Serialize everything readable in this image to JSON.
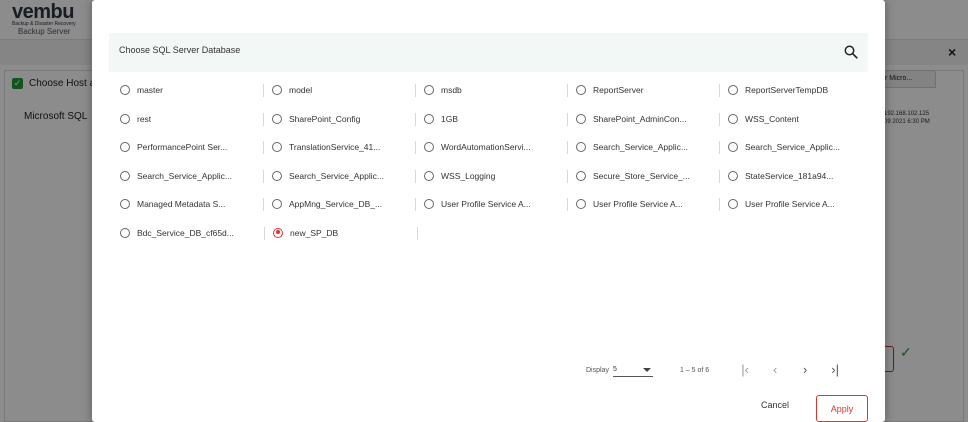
{
  "app": {
    "logo": "vembu",
    "logo_tagline": "Backup & Disaster Recovery",
    "header_subtitle": "Backup Server",
    "close_symbol": "×",
    "choose_host_label": "Choose Host a",
    "microsoft_label": "Microsoft SQL",
    "tab_label": "r Micro...",
    "host_ip": "192.168.102.125",
    "host_date": "09 2021 6:30 PM",
    "tick_symbol": "✓"
  },
  "modal": {
    "title": "Choose SQL Server Database",
    "search_icon": "search-icon",
    "databases": [
      [
        {
          "label": "master",
          "selected": false
        },
        {
          "label": "model",
          "selected": false
        },
        {
          "label": "msdb",
          "selected": false
        },
        {
          "label": "ReportServer",
          "selected": false
        },
        {
          "label": "ReportServerTempDB",
          "selected": false
        }
      ],
      [
        {
          "label": "rest",
          "selected": false
        },
        {
          "label": "SharePoint_Config",
          "selected": false
        },
        {
          "label": "1GB",
          "selected": false
        },
        {
          "label": "SharePoint_AdminCon...",
          "selected": false
        },
        {
          "label": "WSS_Content",
          "selected": false
        }
      ],
      [
        {
          "label": "PerformancePoint Ser...",
          "selected": false
        },
        {
          "label": "TranslationService_41...",
          "selected": false
        },
        {
          "label": "WordAutomationServi...",
          "selected": false
        },
        {
          "label": "Search_Service_Applic...",
          "selected": false
        },
        {
          "label": "Search_Service_Applic...",
          "selected": false
        }
      ],
      [
        {
          "label": "Search_Service_Applic...",
          "selected": false
        },
        {
          "label": "Search_Service_Applic...",
          "selected": false
        },
        {
          "label": "WSS_Logging",
          "selected": false
        },
        {
          "label": "Secure_Store_Service_...",
          "selected": false
        },
        {
          "label": "StateService_181a94...",
          "selected": false
        }
      ],
      [
        {
          "label": "Managed Metadata S...",
          "selected": false
        },
        {
          "label": "AppMng_Service_DB_...",
          "selected": false
        },
        {
          "label": "User Profile Service A...",
          "selected": false
        },
        {
          "label": "User Profile Service A...",
          "selected": false
        },
        {
          "label": "User Profile Service A...",
          "selected": false
        }
      ],
      [
        {
          "label": "Bdc_Service_DB_cf65d...",
          "selected": false
        },
        {
          "label": "new_SP_DB",
          "selected": true
        }
      ]
    ],
    "pagination": {
      "display_label": "Display",
      "display_value": "5",
      "range_text": "1 – 5 of 6",
      "first_symbol": "|<",
      "prev_symbol": "<",
      "next_symbol": ">",
      "last_symbol": ">|"
    },
    "buttons": {
      "cancel": "Cancel",
      "apply": "Apply"
    },
    "colors": {
      "accent": "#e0332f",
      "search_bar_bg": "#f2f8f5"
    }
  }
}
